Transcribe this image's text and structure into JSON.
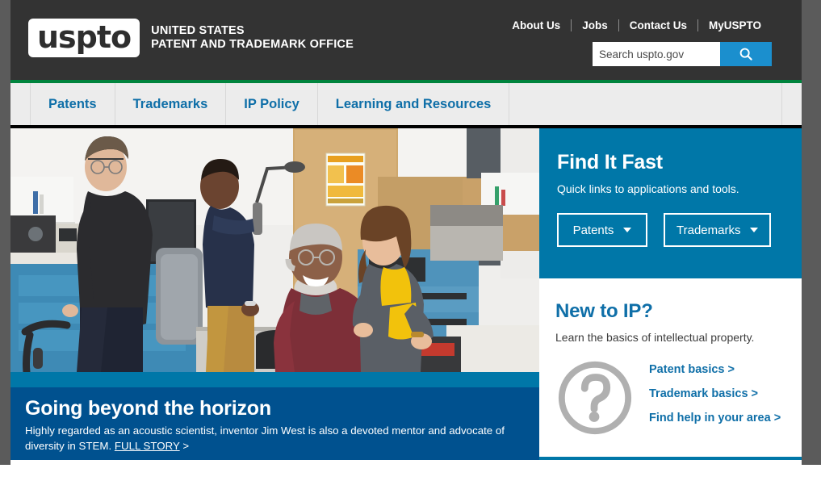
{
  "header": {
    "logo_text": "uspto",
    "logo_subtitle_line1": "UNITED STATES",
    "logo_subtitle_line2": "PATENT AND TRADEMARK OFFICE",
    "utility_links": [
      {
        "label": "About Us"
      },
      {
        "label": "Jobs"
      },
      {
        "label": "Contact Us"
      },
      {
        "label": "MyUSPTO"
      }
    ],
    "search": {
      "placeholder": "Search uspto.gov",
      "value": "",
      "icon": "search-icon"
    },
    "accent_green": "#00843d",
    "background": "#333333"
  },
  "main_nav": {
    "items": [
      {
        "label": "Patents"
      },
      {
        "label": "Trademarks"
      },
      {
        "label": "IP Policy"
      },
      {
        "label": "Learning and Resources"
      }
    ],
    "background": "#ececec",
    "link_color": "#0f6fa8"
  },
  "hero": {
    "alt": "Four researchers collaborating in a laboratory with electronic test equipment",
    "caption": {
      "title": "Going beyond the horizon",
      "description": "Highly regarded as an acoustic scientist, inventor Jim West is also a devoted mentor and advocate of diversity in STEM.",
      "link_label": "FULL STORY",
      "link_suffix": ">"
    },
    "banner_color": "#00518f",
    "strip_color": "#0077a8"
  },
  "find_it_fast": {
    "title": "Find It Fast",
    "subtitle": "Quick links to applications and tools.",
    "buttons": [
      {
        "label": "Patents",
        "icon": "chevron-down-icon"
      },
      {
        "label": "Trademarks",
        "icon": "chevron-down-icon"
      }
    ],
    "background": "#0077a8"
  },
  "new_to_ip": {
    "title": "New to IP?",
    "subtitle": "Learn the basics of intellectual property.",
    "icon": "question-mark-circle-icon",
    "links": [
      {
        "label": "Patent basics >"
      },
      {
        "label": "Trademark basics >"
      },
      {
        "label": "Find help in your area >"
      }
    ],
    "title_color": "#0f6fa8"
  }
}
